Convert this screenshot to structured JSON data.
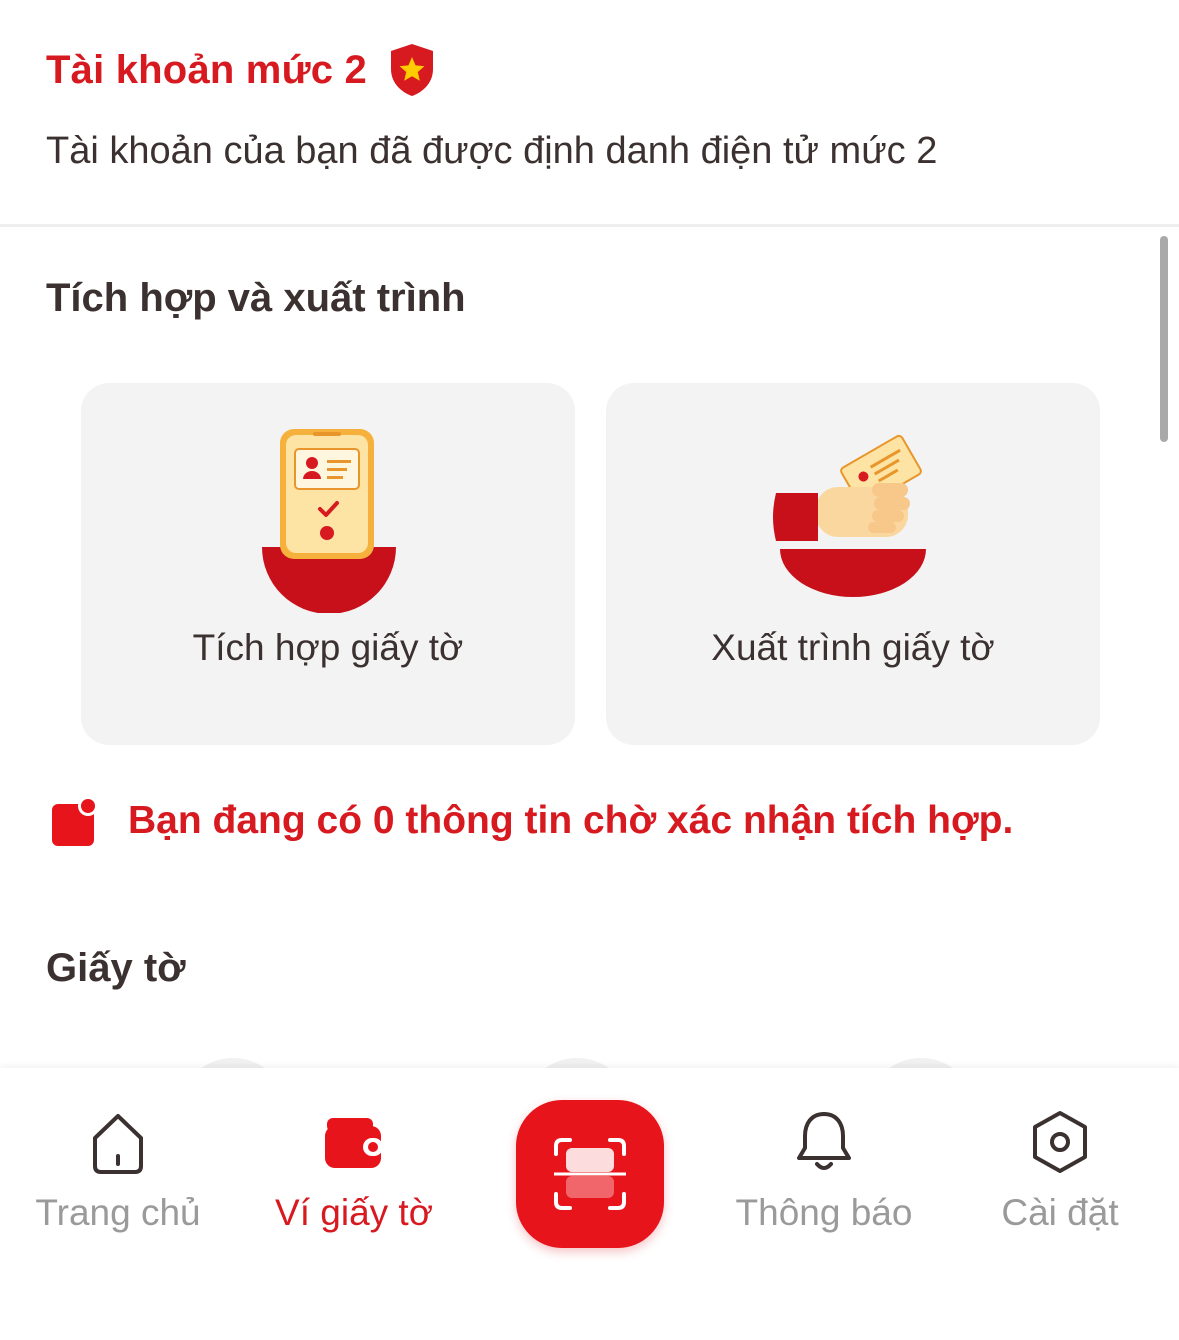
{
  "account": {
    "title": "Tài khoản mức 2",
    "description": "Tài khoản của bạn đã được định danh điện tử mức 2"
  },
  "integration": {
    "section_title": "Tích hợp và xuất trình",
    "cards": [
      {
        "label": "Tích hợp giấy tờ",
        "icon": "phone-id-card-icon"
      },
      {
        "label": "Xuất trình giấy tờ",
        "icon": "hand-card-icon"
      }
    ],
    "pending_text": "Bạn đang có 0 thông tin chờ xác nhận tích hợp."
  },
  "documents": {
    "section_title": "Giấy tờ"
  },
  "bottom_nav": {
    "items": [
      {
        "label": "Trang chủ",
        "icon": "home-icon"
      },
      {
        "label": "Ví giấy tờ",
        "icon": "wallet-icon",
        "active": true
      },
      {
        "label": "Thông báo",
        "icon": "bell-icon"
      },
      {
        "label": "Cài đặt",
        "icon": "settings-icon"
      }
    ],
    "scan_icon": "qr-scan-icon"
  },
  "colors": {
    "accent": "#d71920",
    "text": "#3b3130",
    "card_bg": "#f3f3f3",
    "inactive": "#9a9a9a"
  }
}
